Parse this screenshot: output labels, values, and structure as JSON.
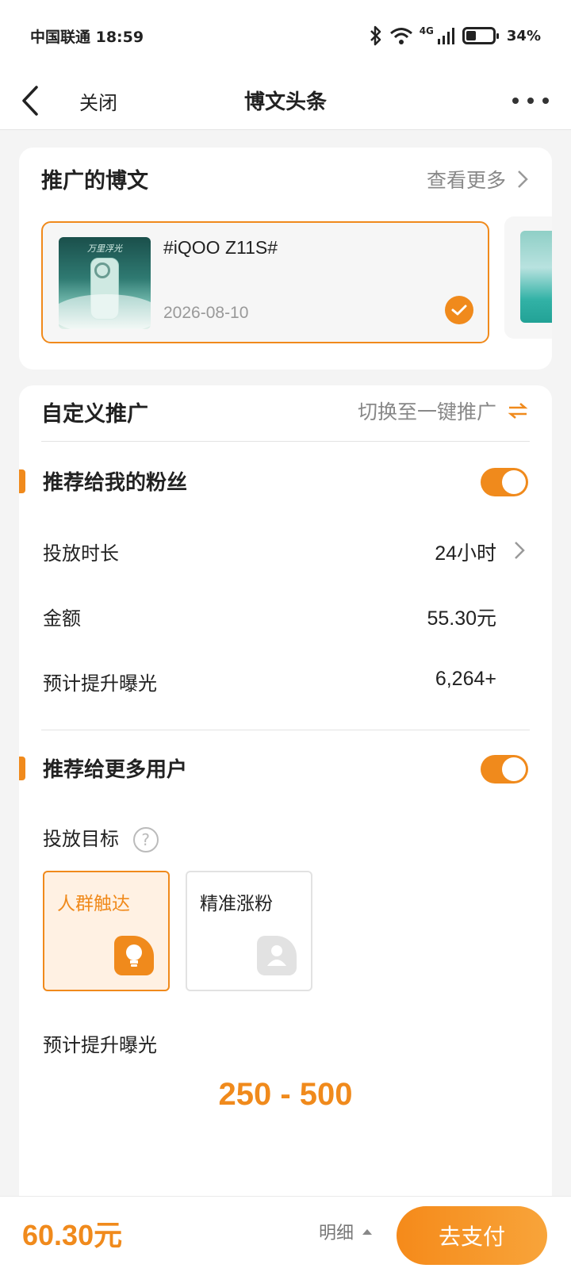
{
  "status_bar": {
    "carrier_time": "中国联通 18:59",
    "network": "4G",
    "battery": "34%"
  },
  "nav": {
    "close": "关闭",
    "title": "博文头条"
  },
  "promoted": {
    "title": "推广的博文",
    "more": "查看更多",
    "post": {
      "thumb_text": "万里浮光",
      "title": "#iQOO Z11S#",
      "date": "2026-08-10"
    }
  },
  "custom": {
    "title": "自定义推广",
    "switch_label": "切换至一键推广"
  },
  "fans_section": {
    "title": "推荐给我的粉丝",
    "enabled": true,
    "rows": [
      {
        "label": "投放时长",
        "value": "24小时"
      },
      {
        "label": "金额",
        "value": "55.30元"
      },
      {
        "label": "预计提升曝光",
        "value": "6,264+"
      }
    ]
  },
  "more_users_section": {
    "title": "推荐给更多用户",
    "enabled": true,
    "target_label": "投放目标",
    "help": "?",
    "targets": [
      {
        "label": "人群触达",
        "selected": true,
        "icon": "bulb-icon"
      },
      {
        "label": "精准涨粉",
        "selected": false,
        "icon": "person-icon"
      }
    ],
    "exposure_label": "预计提升曝光",
    "exposure_range": "250 - 500"
  },
  "bottom": {
    "total": "60.30元",
    "detail": "明细",
    "pay": "去支付"
  },
  "colors": {
    "accent": "#f08a1c",
    "background": "#f4f4f4"
  }
}
